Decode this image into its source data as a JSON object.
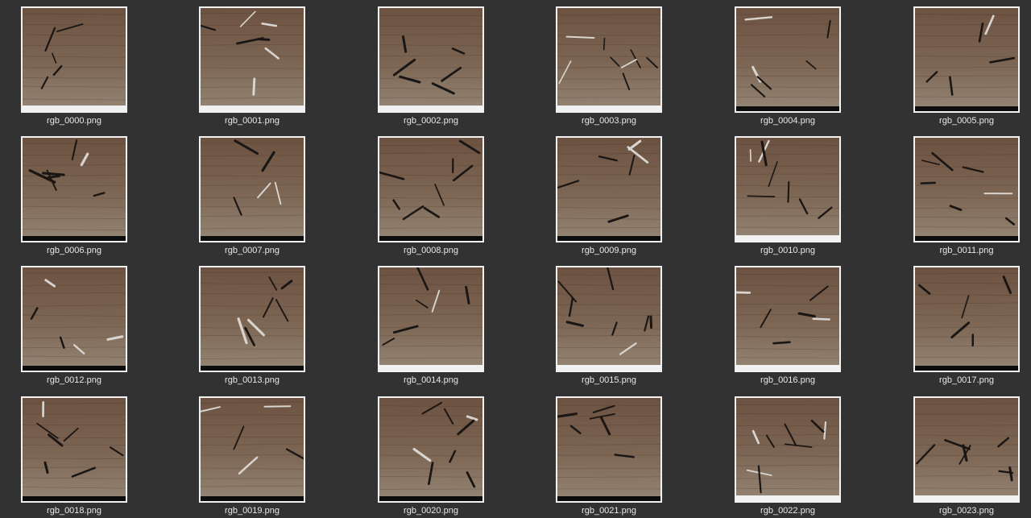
{
  "files": [
    {
      "name": "rgb_0000.png",
      "bottom": "white"
    },
    {
      "name": "rgb_0001.png",
      "bottom": "white"
    },
    {
      "name": "rgb_0002.png",
      "bottom": "white"
    },
    {
      "name": "rgb_0003.png",
      "bottom": "white"
    },
    {
      "name": "rgb_0004.png",
      "bottom": "black"
    },
    {
      "name": "rgb_0005.png",
      "bottom": "black"
    },
    {
      "name": "rgb_0006.png",
      "bottom": "black"
    },
    {
      "name": "rgb_0007.png",
      "bottom": "black"
    },
    {
      "name": "rgb_0008.png",
      "bottom": "black"
    },
    {
      "name": "rgb_0009.png",
      "bottom": "black"
    },
    {
      "name": "rgb_0010.png",
      "bottom": "white"
    },
    {
      "name": "rgb_0011.png",
      "bottom": "black"
    },
    {
      "name": "rgb_0012.png",
      "bottom": "black"
    },
    {
      "name": "rgb_0013.png",
      "bottom": "black"
    },
    {
      "name": "rgb_0014.png",
      "bottom": "white"
    },
    {
      "name": "rgb_0015.png",
      "bottom": "white"
    },
    {
      "name": "rgb_0016.png",
      "bottom": "white"
    },
    {
      "name": "rgb_0017.png",
      "bottom": "black"
    },
    {
      "name": "rgb_0018.png",
      "bottom": "black"
    },
    {
      "name": "rgb_0019.png",
      "bottom": "black"
    },
    {
      "name": "rgb_0020.png",
      "bottom": "black"
    },
    {
      "name": "rgb_0021.png",
      "bottom": "black"
    },
    {
      "name": "rgb_0022.png",
      "bottom": "white"
    },
    {
      "name": "rgb_0023.png",
      "bottom": "white"
    }
  ],
  "colors": {
    "background": "#323232",
    "label_text": "#e8e8e8",
    "thumb_border": "#f2f2f2",
    "wood_top": "#6d5241",
    "wood_bottom": "#958675"
  }
}
